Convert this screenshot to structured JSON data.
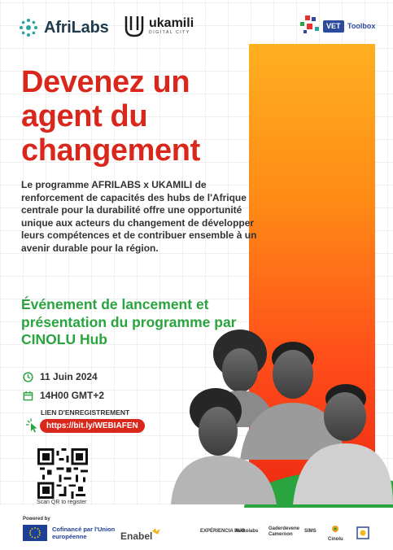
{
  "header": {
    "afrilabs": "AfriLabs",
    "ukamili_name": "ukamili",
    "ukamili_sub": "DIGITAL CITY",
    "vet_pill": "VET",
    "vet_tool": "Toolbox"
  },
  "headline": "Devenez un agent du changement",
  "intro": "Le programme AFRILABS x UKAMILI de renforcement de capacités des hubs de l'Afrique centrale pour la durabilité offre une opportunité unique aux acteurs du changement de développer leurs compétences et de contribuer ensemble à un avenir durable pour la région.",
  "event_title": "Événement de lancement et présentation du programme par CINOLU Hub",
  "date": "11 Juin 2024",
  "time": "14H00 GMT+2",
  "registration": {
    "label": "LIEN D'ENREGISTREMENT",
    "url": "https://bit.ly/WEBIAFEN"
  },
  "qr_caption": "Scan QR to register",
  "footer": {
    "powered_by": "Powered by",
    "eu_text": "Cofinancé par l'Union européenne",
    "enabel": "Enabel",
    "partners": [
      "EXPÉRIENCIA HUB",
      "Jokkolabs",
      "Gaderdevene Cameroon",
      "SIMS",
      "Cinolu"
    ]
  },
  "colors": {
    "headline": "#d9271c",
    "event_title": "#2aa43f",
    "orange_top": "#ffb020",
    "orange_bottom": "#ee2a12",
    "link_bg": "#d9271c"
  }
}
